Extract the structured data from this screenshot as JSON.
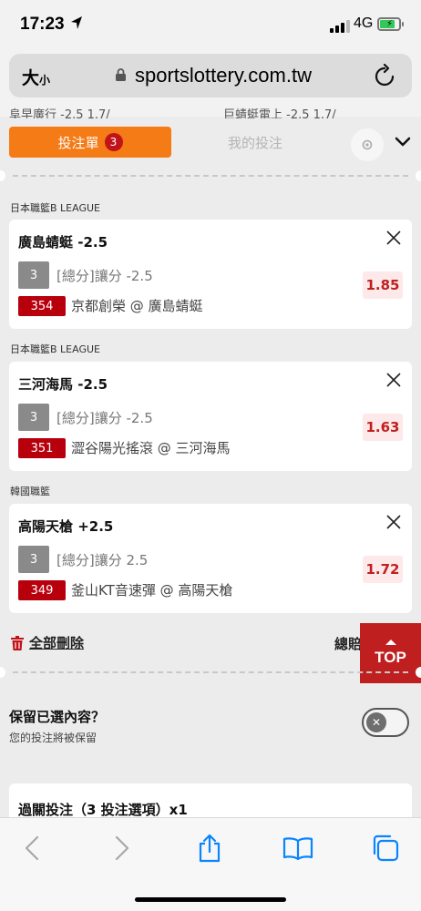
{
  "status": {
    "time": "17:23",
    "network": "4G"
  },
  "browser": {
    "text_size_label": "大",
    "text_size_small": "小",
    "url": "sportslottery.com.tw"
  },
  "peek": {
    "left": "阜早廣行 -2.5        1.7/",
    "right": "巨蜻蜓電上 -2.5        1.7/"
  },
  "tabs": {
    "active_label": "投注單",
    "active_count": "3",
    "other_label": "我的投注"
  },
  "bets": [
    {
      "league": "日本職籃B LEAGUE",
      "team": "廣島蜻蜓 -2.5",
      "type_no": "3",
      "type_text": "[總分]讓分 -2.5",
      "game_no": "354",
      "match": "京都創榮 @ 廣島蜻蜓",
      "odds": "1.85"
    },
    {
      "league": "日本職籃B LEAGUE",
      "team": "三河海馬 -2.5",
      "type_no": "3",
      "type_text": "[總分]讓分 -2.5",
      "game_no": "351",
      "match": "澀谷陽光搖滾 @ 三河海馬",
      "odds": "1.63"
    },
    {
      "league": "韓國職籃",
      "team": "高陽天槍 +2.5",
      "type_no": "3",
      "type_text": "[總分]讓分 2.5",
      "game_no": "349",
      "match": "釜山KT音速彈 @ 高陽天槍",
      "odds": "1.72"
    }
  ],
  "actions": {
    "delete_all": "全部刪除",
    "total": "總賠",
    "top": "TOP"
  },
  "keep": {
    "title": "保留已選內容？",
    "subtitle": "您的投注將被保留",
    "enabled": false
  },
  "parlay": {
    "title": "過關投注（3 投注選項）x1"
  },
  "colors": {
    "accent": "#f47b16",
    "badge": "#c0141a",
    "game_no": "#b8000d",
    "odds_text": "#c01f1f",
    "top_button": "#bf1f1f",
    "ios_blue": "#0a84ff"
  }
}
